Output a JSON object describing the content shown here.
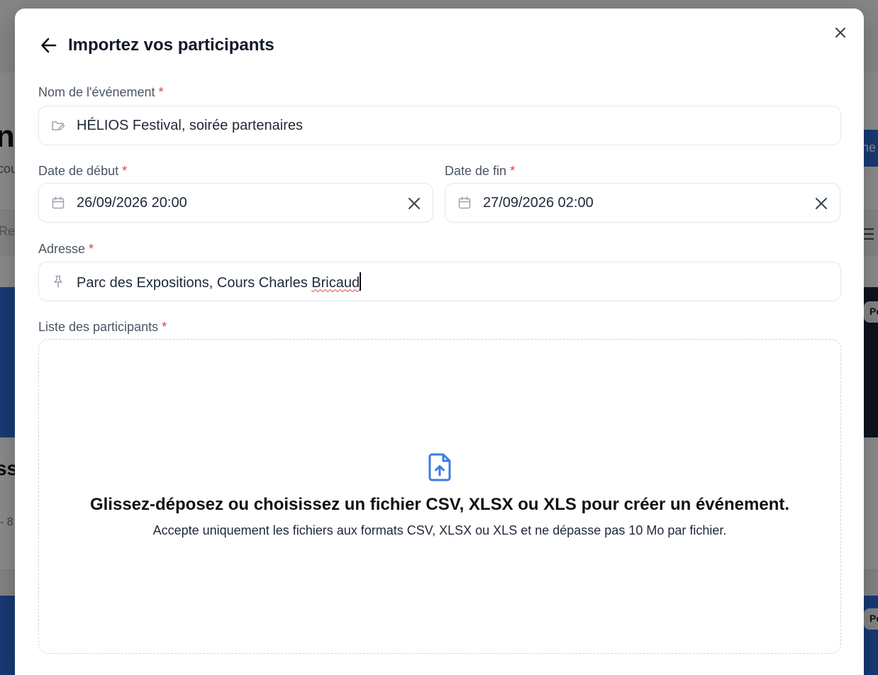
{
  "background": {
    "title_fragment": "n",
    "subtitle_fragment": "cou",
    "button_fragment": "ne",
    "search_fragment": "Re",
    "pill_fragment": "Pe",
    "card_title_fragment": "ss",
    "card_meta_fragment": "- 8",
    "pill2_fragment": "Pe"
  },
  "modal": {
    "title": "Importez vos participants",
    "back_icon": "arrow-left-icon",
    "close_icon": "close-icon"
  },
  "fields": {
    "event_name": {
      "label": "Nom de l'événement",
      "required_mark": "*",
      "value": "HÉLIOS Festival, soirée partenaires",
      "icon": "folder-edit-icon"
    },
    "start_date": {
      "label": "Date de début",
      "required_mark": "*",
      "value": "26/09/2026 20:00",
      "icon": "calendar-icon"
    },
    "end_date": {
      "label": "Date de fin",
      "required_mark": "*",
      "value": "27/09/2026 02:00",
      "icon": "calendar-icon"
    },
    "address": {
      "label": "Adresse",
      "required_mark": "*",
      "value_main": "Parc des Expositions, Cours Charles ",
      "value_misspelled": "Bricaud",
      "icon": "pin-icon"
    },
    "participants": {
      "label": "Liste des participants",
      "required_mark": "*"
    }
  },
  "dropzone": {
    "icon": "file-upload-icon",
    "title": "Glissez-déposez ou choisissez un fichier CSV, XLSX ou XLS pour créer un événement.",
    "subtitle": "Accepte uniquement les fichiers aux formats CSV, XLSX ou XLS et ne dépasse pas 10 Mo par fichier."
  },
  "colors": {
    "accent": "#2f6bd8",
    "required": "#e53e3e",
    "text": "#111827",
    "border": "#e5e7eb"
  }
}
